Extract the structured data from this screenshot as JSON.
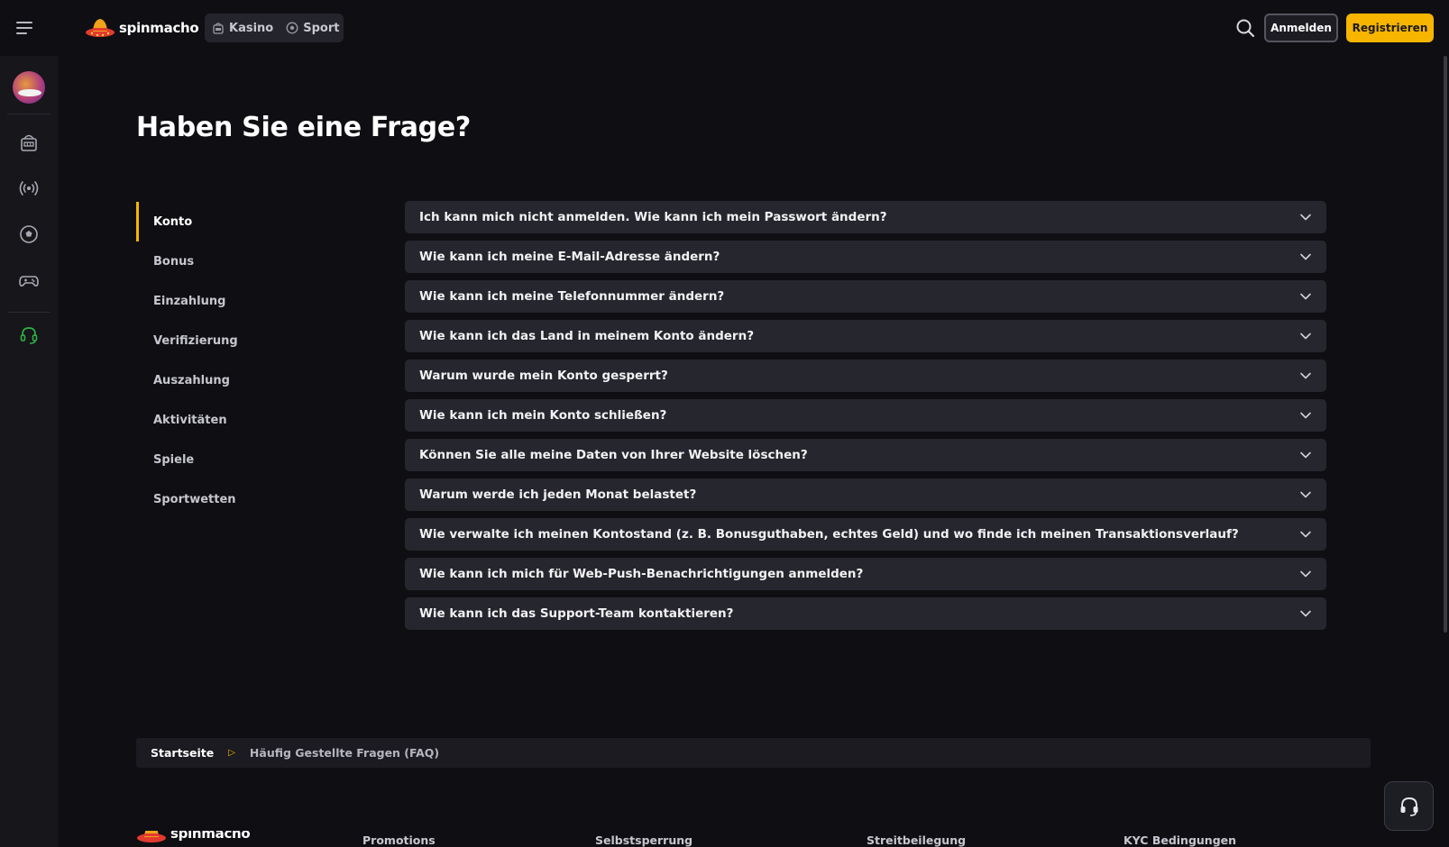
{
  "header": {
    "brand": "spinmacho",
    "modes": [
      {
        "label": "Kasino",
        "icon": "slot-machine-icon"
      },
      {
        "label": "Sport",
        "icon": "soccer-ball-icon"
      }
    ],
    "login_label": "Anmelden",
    "register_label": "Registrieren"
  },
  "rail": {
    "items": [
      {
        "icon": "avatar"
      },
      {
        "icon": "slot-machine-icon"
      },
      {
        "icon": "live-broadcast-icon"
      },
      {
        "icon": "soccer-ball-icon"
      },
      {
        "icon": "gamepad-icon"
      },
      {
        "icon": "support-headset-icon"
      }
    ]
  },
  "page": {
    "title": "Haben Sie eine Frage?"
  },
  "categories": [
    {
      "label": "Konto",
      "active": true
    },
    {
      "label": "Bonus"
    },
    {
      "label": "Einzahlung"
    },
    {
      "label": "Verifizierung"
    },
    {
      "label": "Auszahlung"
    },
    {
      "label": "Aktivitäten"
    },
    {
      "label": "Spiele"
    },
    {
      "label": "Sportwetten"
    }
  ],
  "faqs": [
    "Ich kann mich nicht anmelden. Wie kann ich mein Passwort ändern?",
    "Wie kann ich meine E-Mail-Adresse ändern?",
    "Wie kann ich meine Telefonnummer ändern?",
    "Wie kann ich das Land in meinem Konto ändern?",
    "Warum wurde mein Konto gesperrt?",
    "Wie kann ich mein Konto schließen?",
    "Können Sie alle meine Daten von Ihrer Website löschen?",
    "Warum werde ich jeden Monat belastet?",
    "Wie verwalte ich meinen Kontostand (z. B. Bonusguthaben, echtes Geld) und wo finde ich meinen Transaktionsverlauf?",
    "Wie kann ich mich für Web-Push-Benachrichtigungen anmelden?",
    "Wie kann ich das Support-Team kontaktieren?"
  ],
  "breadcrumb": {
    "home": "Startseite",
    "separator": "▷",
    "current": "Häufig Gestellte Fragen (FAQ)"
  },
  "footer": {
    "brand": "spinmacho",
    "links": [
      "Promotions",
      "Selbstsperrung",
      "Streitbeilegung",
      "KYC Bedingungen"
    ]
  },
  "colors": {
    "background": "#0f0f13",
    "accent": "#f7b500",
    "panel": "#26262e",
    "support_green": "#2fb344"
  }
}
